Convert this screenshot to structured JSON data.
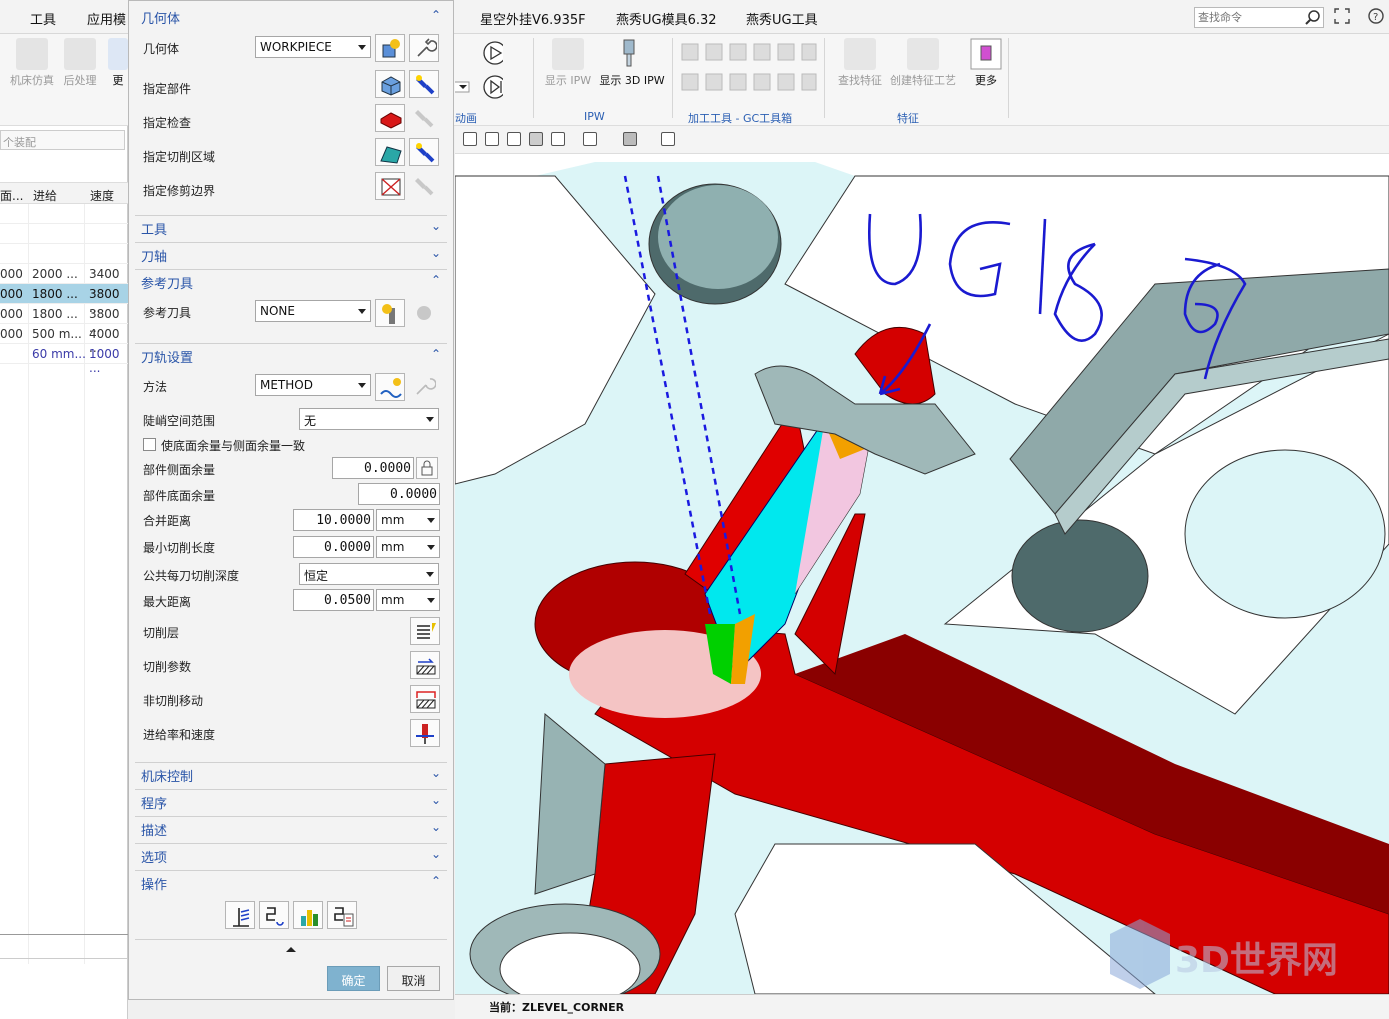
{
  "menubar": {
    "items": [
      "工具",
      "应用模",
      "星空外挂V6.935F",
      "燕秀UG模具6.32",
      "燕秀UG工具"
    ],
    "search_placeholder": "查找命令"
  },
  "ribbon": {
    "buttons": {
      "machine_sim": "机床仿真",
      "post_process": "后处理",
      "more_left": "更",
      "show_ipw": "显示 IPW",
      "show_3d_ipw": "显示 3D IPW",
      "find_feature": "查找特征",
      "create_feature_process": "创建特征工艺",
      "more": "更多"
    },
    "groups": {
      "animation": "动画",
      "ipw": "IPW",
      "tools": "加工工具 - GC工具箱",
      "feature": "特征"
    }
  },
  "navigator": {
    "filter_placeholder": "个装配",
    "columns": [
      "面...",
      "进给",
      "速度"
    ],
    "rows": [
      {
        "c1": "000",
        "c2": "2000 ...",
        "c3": "3400 ...",
        "selected": false
      },
      {
        "c1": "000",
        "c2": "1800 ...",
        "c3": "3800 ...",
        "selected": true
      },
      {
        "c1": "000",
        "c2": "1800 ...",
        "c3": "3800 ...",
        "selected": false
      },
      {
        "c1": "000",
        "c2": "500 m...",
        "c3": "4000 ...",
        "selected": false
      },
      {
        "c1": "",
        "c2": "60 mm...",
        "c3": "1000 ...",
        "selected": false
      }
    ]
  },
  "dialog": {
    "geometry": {
      "title": "几何体",
      "geometry_label": "几何体",
      "geometry_value": "WORKPIECE",
      "specify_part": "指定部件",
      "specify_check": "指定检查",
      "specify_cut_area": "指定切削区域",
      "specify_trim": "指定修剪边界"
    },
    "tool": {
      "title": "工具"
    },
    "axis": {
      "title": "刀轴"
    },
    "ref_tool": {
      "title": "参考刀具",
      "label": "参考刀具",
      "value": "NONE"
    },
    "path": {
      "title": "刀轨设置",
      "method_label": "方法",
      "method_value": "METHOD",
      "steep_label": "陡峭空间范围",
      "steep_value": "无",
      "same_stock_label": "使底面余量与侧面余量一致",
      "side_stock_label": "部件侧面余量",
      "side_stock_value": "0.0000",
      "floor_stock_label": "部件底面余量",
      "floor_stock_value": "0.0000",
      "merge_dist_label": "合并距离",
      "merge_dist_value": "10.0000",
      "merge_dist_unit": "mm",
      "min_cut_label": "最小切削长度",
      "min_cut_value": "0.0000",
      "min_cut_unit": "mm",
      "depth_label": "公共每刀切削深度",
      "depth_value": "恒定",
      "max_dist_label": "最大距离",
      "max_dist_value": "0.0500",
      "max_dist_unit": "mm",
      "cut_levels": "切削层",
      "cut_params": "切削参数",
      "non_cut_moves": "非切削移动",
      "feeds_speeds": "进给率和速度"
    },
    "machine": {
      "title": "机床控制"
    },
    "program": {
      "title": "程序"
    },
    "description": {
      "title": "描述"
    },
    "options": {
      "title": "选项"
    },
    "actions": {
      "title": "操作"
    },
    "ok": "确定",
    "cancel": "取消"
  },
  "viewport": {
    "annotation": "UG1867",
    "watermark": "3D世界网"
  },
  "status": {
    "current": "当前：ZLEVEL_CORNER"
  }
}
